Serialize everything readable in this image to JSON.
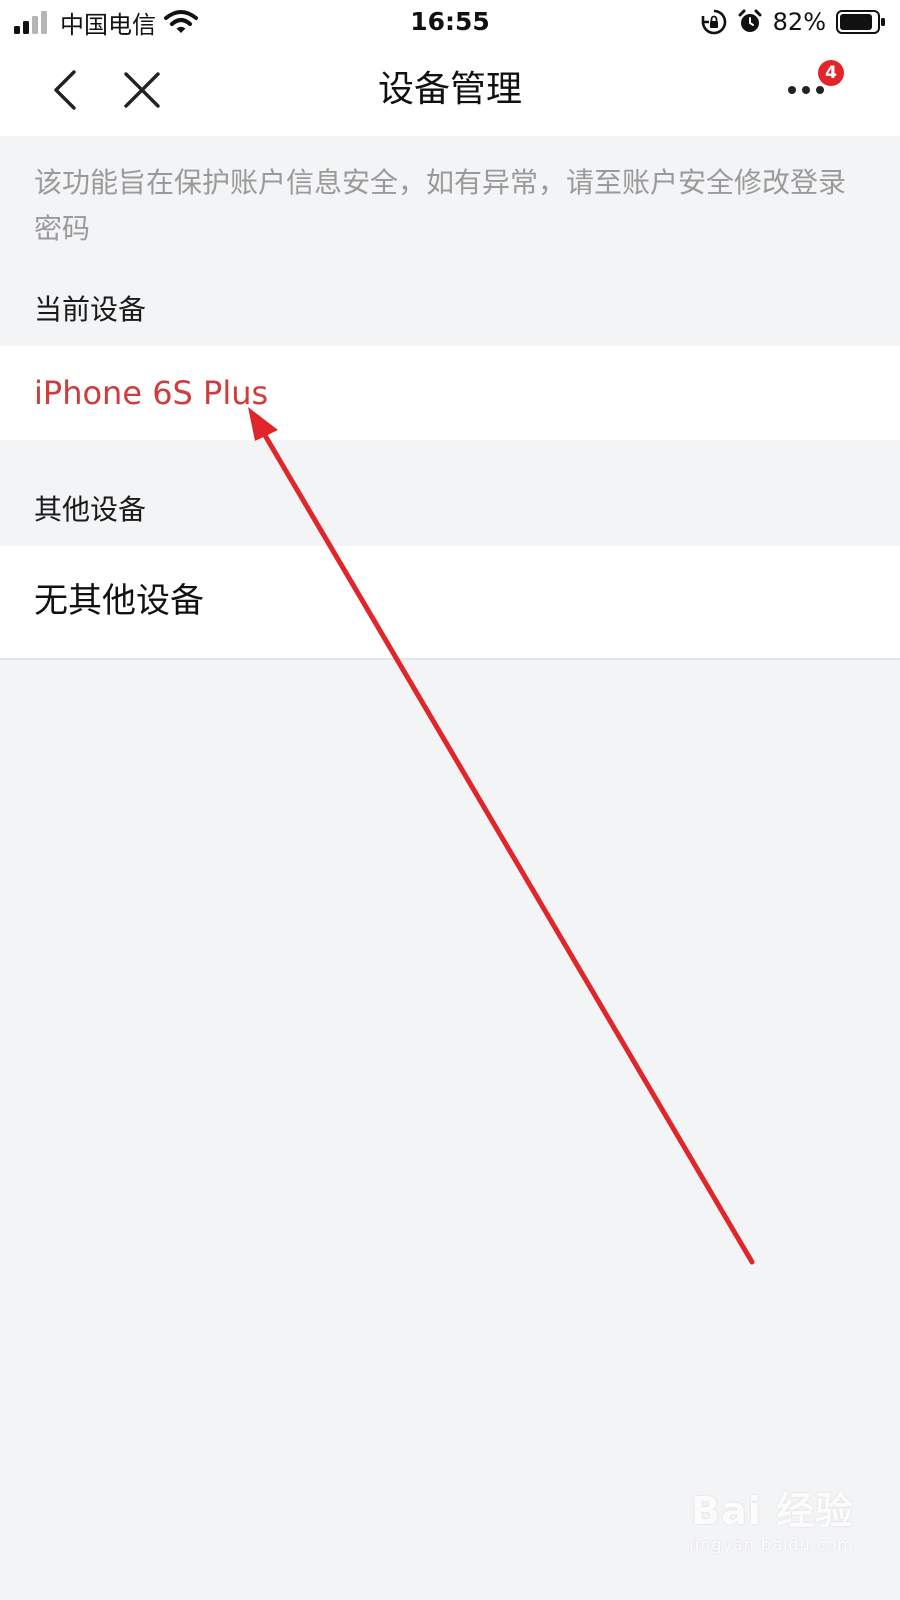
{
  "status_bar": {
    "carrier": "中国电信",
    "time": "16:55",
    "battery": "82%",
    "icons": [
      "signal-icon",
      "wifi-icon",
      "rotation-lock-icon",
      "alarm-icon",
      "battery-icon"
    ]
  },
  "nav": {
    "title": "设备管理",
    "back_icon": "back-arrow-icon",
    "close_icon": "close-icon",
    "more_icon": "more-icon",
    "more_badge": "4"
  },
  "notice": "该功能旨在保护账户信息安全，如有异常，请至账户安全修改登录密码",
  "sections": {
    "current_label": "当前设备",
    "current_device": "iPhone 6S Plus",
    "other_label": "其他设备",
    "other_empty": "无其他设备"
  },
  "colors": {
    "accent_red": "#d13b3b",
    "badge_red": "#e3242b",
    "background": "#f3f4f6",
    "annotation_arrow": "#e0262a"
  },
  "watermark": {
    "logo": "Bai 经验",
    "url": "jingyan.baidu.com"
  }
}
